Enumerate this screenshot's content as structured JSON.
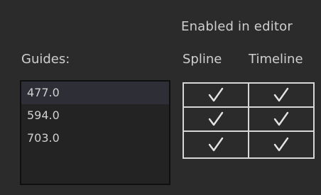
{
  "header": {
    "enabled_in_editor": "Enabled in editor"
  },
  "guides": {
    "label": "Guides:",
    "items": [
      {
        "value": "477.0",
        "selected": true
      },
      {
        "value": "594.0",
        "selected": false
      },
      {
        "value": "703.0",
        "selected": false
      }
    ]
  },
  "columns": {
    "spline": "Spline",
    "timeline": "Timeline"
  },
  "checks": [
    {
      "spline": true,
      "timeline": true
    },
    {
      "spline": true,
      "timeline": true
    },
    {
      "spline": true,
      "timeline": true
    }
  ],
  "colors": {
    "background": "#2b2b2b",
    "list_background": "#232323",
    "text": "#cfcfcf",
    "grid_lines": "#d6d6d6"
  },
  "icons": {
    "check": "check-icon"
  }
}
